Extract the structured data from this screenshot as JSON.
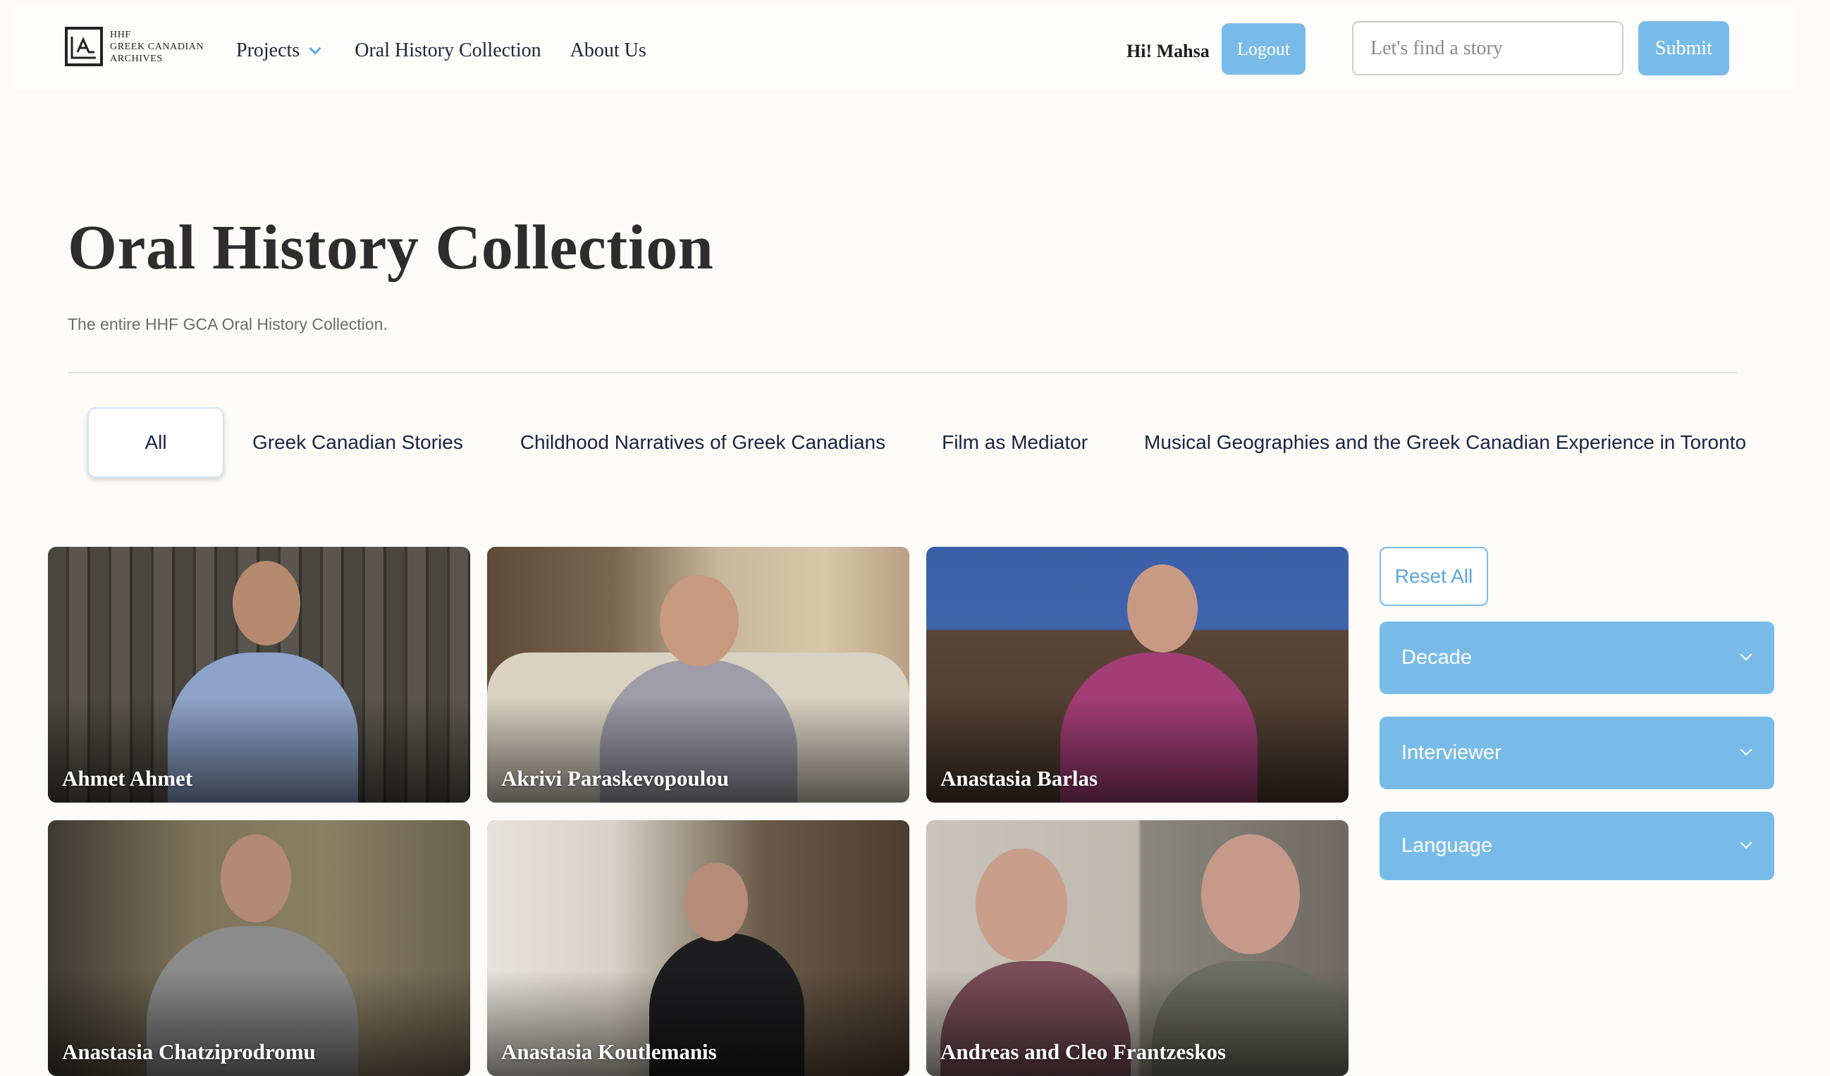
{
  "nav": {
    "logo_line1": "HHF",
    "logo_line2": "GREEK CANADIAN",
    "logo_line3": "ARCHIVES",
    "projects_label": "Projects",
    "oral_history_label": "Oral History Collection",
    "about_label": "About Us",
    "greeting": "Hi! Mahsa",
    "logout_label": "Logout",
    "search_placeholder": "Let's find a story",
    "submit_label": "Submit"
  },
  "header": {
    "title": "Oral History Collection",
    "subtitle": "The entire HHF GCA Oral History Collection."
  },
  "tabs": [
    {
      "label": "All",
      "active": true
    },
    {
      "label": "Greek Canadian Stories"
    },
    {
      "label": "Childhood Narratives of Greek Canadians"
    },
    {
      "label": "Film as Mediator"
    },
    {
      "label": "Musical Geographies and the Greek Canadian Experience in Toronto"
    }
  ],
  "cards": [
    {
      "name": "Ahmet Ahmet"
    },
    {
      "name": "Akrivi Paraskevopoulou"
    },
    {
      "name": "Anastasia Barlas"
    },
    {
      "name": "Anastasia Chatziprodromu"
    },
    {
      "name": "Anastasia Koutlemanis"
    },
    {
      "name": "Andreas and Cleo Frantzeskos"
    }
  ],
  "filters": {
    "reset_label": "Reset All",
    "items": [
      {
        "label": "Decade"
      },
      {
        "label": "Interviewer"
      },
      {
        "label": "Language"
      }
    ]
  },
  "colors": {
    "accent": "#79bbe8",
    "background": "#fcfbf8",
    "title_text": "#2d2d2d"
  },
  "icons": [
    "logo-mark-icon",
    "chevron-down-icon"
  ]
}
